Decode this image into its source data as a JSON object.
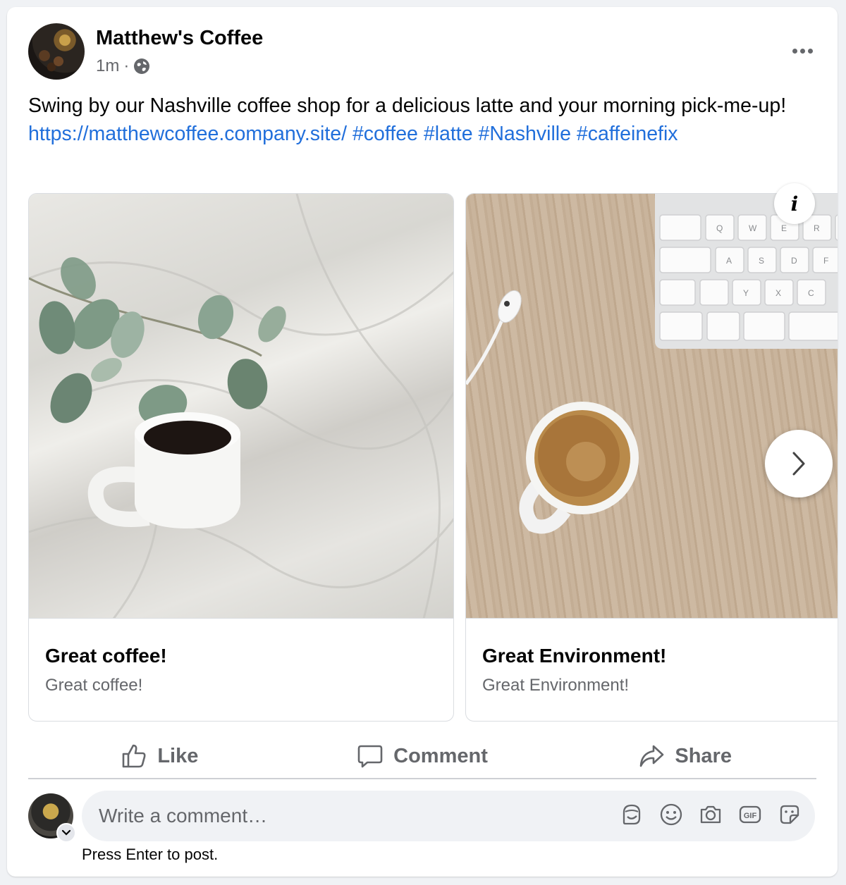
{
  "post": {
    "page_name": "Matthew's Coffee",
    "time": "1m",
    "separator": "·",
    "text_before_link": "Swing by our Nashville coffee shop for a delicious latte and your morning pick-me-up! ",
    "link": "https://matthewcoffee.company.site/",
    "hashtags": [
      "#coffee",
      "#latte",
      "#Nashville",
      "#caffeinefix"
    ]
  },
  "carousel": {
    "cards": [
      {
        "title": "Great coffee!",
        "description": "Great coffee!"
      },
      {
        "title": "Great Environment!",
        "description": "Great Environment!"
      }
    ],
    "keyboard_keys": [
      "Q",
      "W",
      "E",
      "R",
      "A",
      "S",
      "D",
      "F",
      "Y",
      "X",
      "C"
    ]
  },
  "actions": {
    "like": "Like",
    "comment": "Comment",
    "share": "Share"
  },
  "comment": {
    "placeholder": "Write a comment…",
    "hint": "Press Enter to post.",
    "icons": [
      "avatar-sticker-icon",
      "emoji-icon",
      "camera-icon",
      "gif-icon",
      "sticker-icon"
    ]
  },
  "colors": {
    "link": "#216fdb",
    "secondary_text": "#65676b",
    "background": "#f0f2f5"
  }
}
